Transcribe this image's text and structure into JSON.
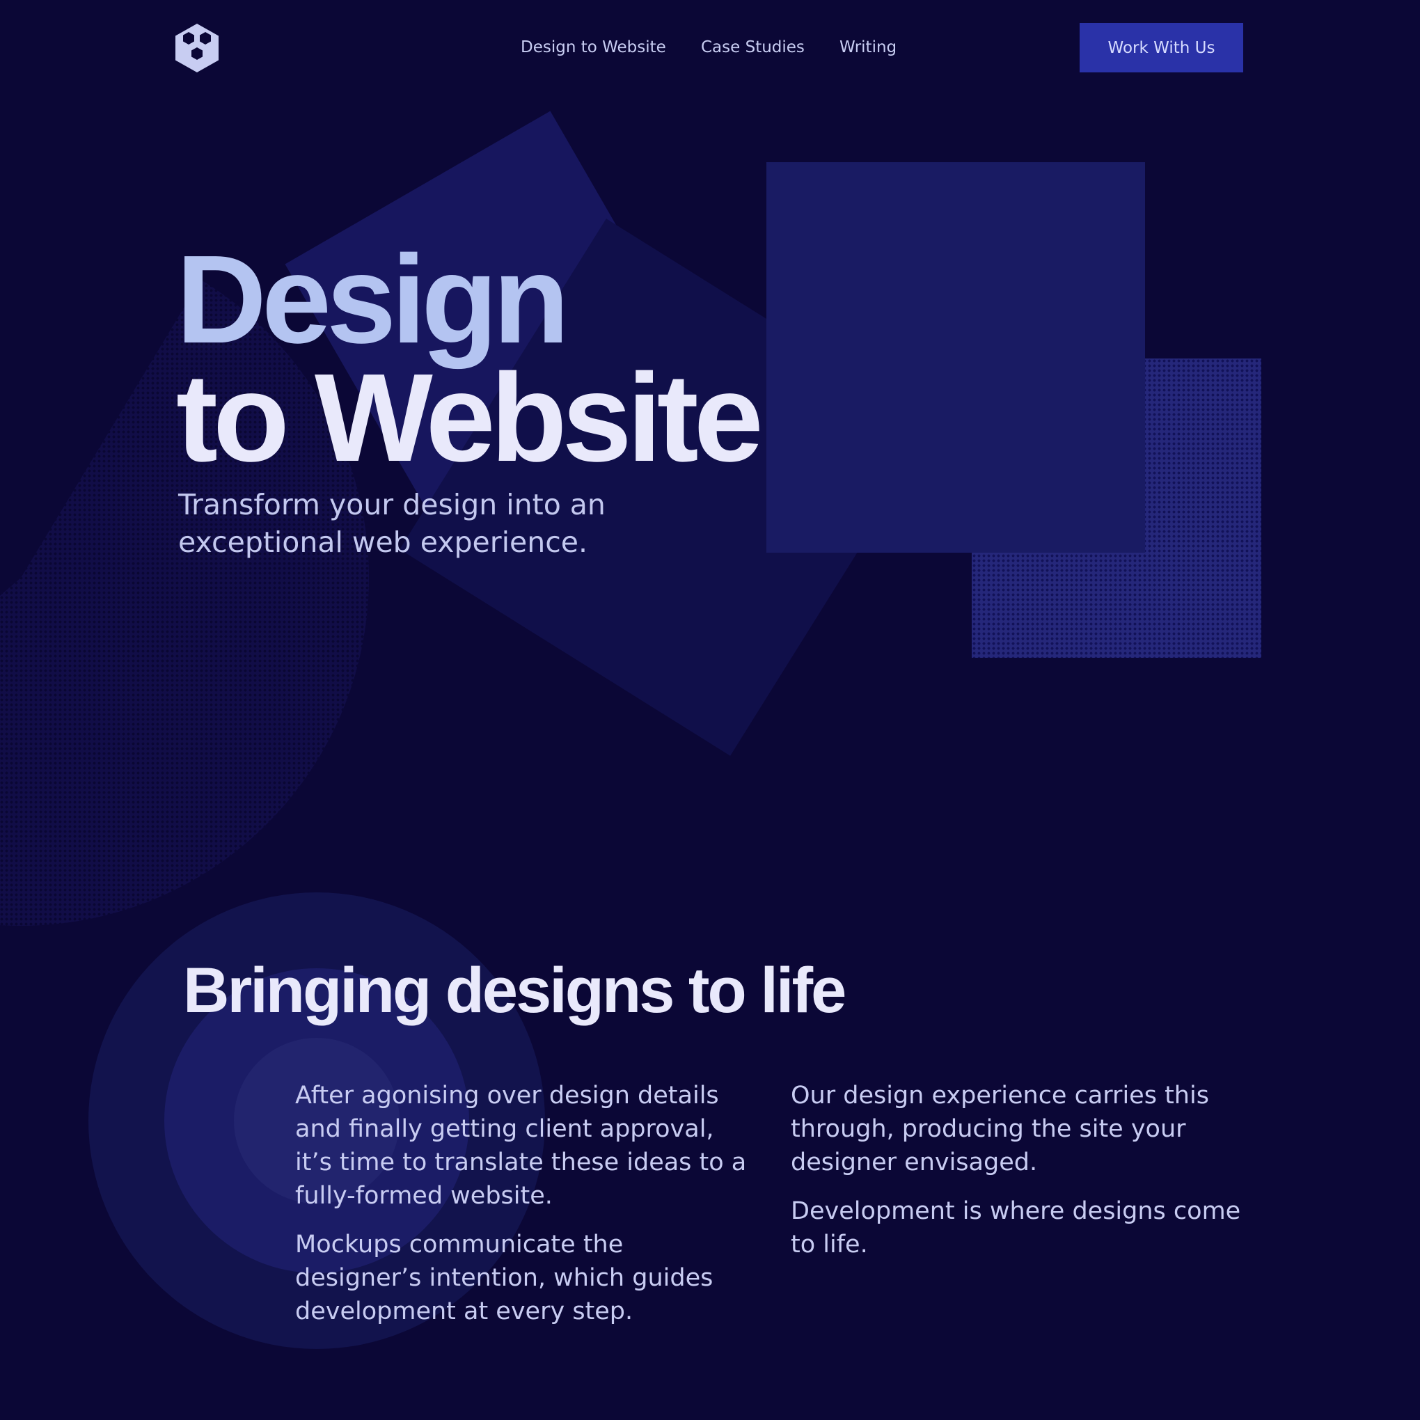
{
  "colors": {
    "background": "#0b0736",
    "accent": "#2a32a8",
    "heading_light": "#e9e9fb",
    "heading_tint": "#b4c4f1",
    "body_text": "#c8ccf2"
  },
  "nav": {
    "logo_icon": "hexagon-cluster-icon",
    "links": [
      "Design to Website",
      "Case Studies",
      "Writing"
    ],
    "cta_label": "Work With Us"
  },
  "hero": {
    "title_line1": "Design",
    "title_line2": "to Website",
    "subtitle": "Transform your design into an exceptional web experience."
  },
  "section": {
    "title": "Bringing designs to life",
    "col1": [
      "After agonising over design details and finally getting client approval, it’s time to translate these ideas to a fully-formed website.",
      "Mockups communicate the designer’s intention, which guides development at every step."
    ],
    "col2": [
      "Our design experience carries this through, producing the site your designer envisaged.",
      "Development is where designs come to life."
    ]
  }
}
